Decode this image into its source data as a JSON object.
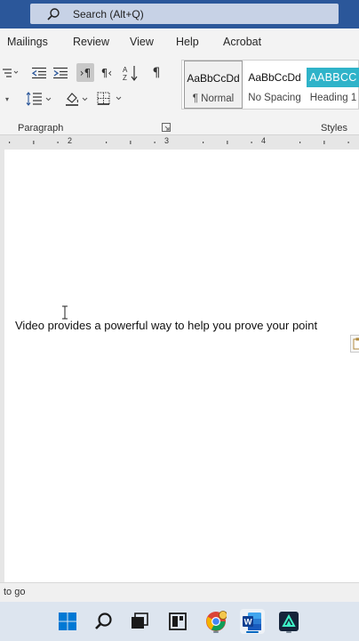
{
  "search": {
    "placeholder": "Search (Alt+Q)"
  },
  "tabs": [
    {
      "label": "Mailings"
    },
    {
      "label": "Review"
    },
    {
      "label": "View"
    },
    {
      "label": "Help"
    },
    {
      "label": "Acrobat"
    }
  ],
  "ribbon": {
    "paragraph_label": "Paragraph",
    "styles_label": "Styles",
    "pilcrow": "¶",
    "ltr": "¶",
    "rtl": "¶"
  },
  "styles": [
    {
      "preview": "AaBbCcDd",
      "name": "¶ Normal"
    },
    {
      "preview": "AaBbCcDd",
      "name": "No Spacing"
    },
    {
      "preview": "AABBCC",
      "name": "Heading 1"
    }
  ],
  "ruler": {
    "marks": [
      "2",
      "3",
      "4"
    ]
  },
  "document": {
    "line": "Video provides a powerful way to help you prove your point"
  },
  "status": {
    "text": "to go"
  },
  "taskbar": [
    {
      "name": "Start"
    },
    {
      "name": "Search"
    },
    {
      "name": "Task View"
    },
    {
      "name": "Widgets"
    },
    {
      "name": "Chrome"
    },
    {
      "name": "Word"
    },
    {
      "name": "Filmora"
    }
  ]
}
